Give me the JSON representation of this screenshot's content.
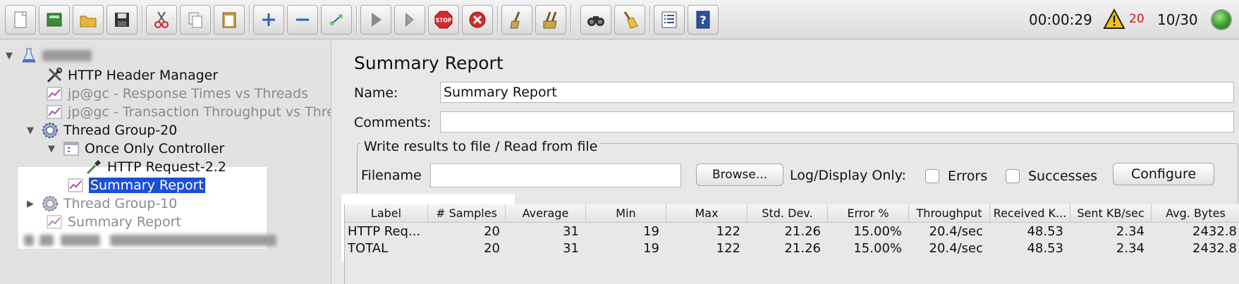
{
  "toolbar": {
    "buttons": [
      {
        "name": "new-icon"
      },
      {
        "name": "templates-icon"
      },
      {
        "name": "open-icon"
      },
      {
        "name": "save-icon"
      },
      {
        "name": "cut-icon"
      },
      {
        "name": "copy-icon"
      },
      {
        "name": "paste-icon"
      },
      {
        "name": "expand-icon"
      },
      {
        "name": "collapse-icon"
      },
      {
        "name": "toggle-icon"
      },
      {
        "name": "start-icon"
      },
      {
        "name": "start-no-pauses-icon"
      },
      {
        "name": "stop-icon"
      },
      {
        "name": "shutdown-icon"
      },
      {
        "name": "clear-icon"
      },
      {
        "name": "clear-all-icon"
      },
      {
        "name": "search-icon"
      },
      {
        "name": "reset-search-icon"
      },
      {
        "name": "function-helper-icon"
      },
      {
        "name": "help-icon"
      }
    ],
    "stop_text": "STOP",
    "timer": "00:00:29",
    "warning_count": "20",
    "threads": "10/30"
  },
  "tree": {
    "root_label": "",
    "items": [
      {
        "label": "HTTP Header Manager"
      },
      {
        "label": "jp@gc - Response Times vs Threads"
      },
      {
        "label": "jp@gc - Transaction Throughput vs Threa"
      },
      {
        "label": "Thread Group-20"
      },
      {
        "label": "Once Only Controller"
      },
      {
        "label": "HTTP Request-2.2"
      },
      {
        "label": "Summary Report"
      },
      {
        "label": "Thread Group-10"
      },
      {
        "label": "Summary Report"
      }
    ]
  },
  "panel": {
    "title": "Summary Report",
    "name_label": "Name:",
    "name_value": "Summary Report",
    "comments_label": "Comments:",
    "comments_value": "",
    "file_group_title": "Write results to file / Read from file",
    "filename_label": "Filename",
    "filename_value": "",
    "browse_label": "Browse...",
    "log_display_label": "Log/Display Only:",
    "errors_label": "Errors",
    "successes_label": "Successes",
    "configure_label": "Configure"
  },
  "table": {
    "headers": [
      "Label",
      "# Samples",
      "Average",
      "Min",
      "Max",
      "Std. Dev.",
      "Error %",
      "Throughput",
      "Received K...",
      "Sent KB/sec",
      "Avg. Bytes"
    ],
    "rows": [
      [
        "HTTP Req...",
        "20",
        "31",
        "19",
        "122",
        "21.26",
        "15.00%",
        "20.4/sec",
        "48.53",
        "2.34",
        "2432.8"
      ],
      [
        "TOTAL",
        "20",
        "31",
        "19",
        "122",
        "21.26",
        "15.00%",
        "20.4/sec",
        "48.53",
        "2.34",
        "2432.8"
      ]
    ]
  },
  "colors": {
    "selection": "#1a4fd6",
    "warning": "#d0161b",
    "status": "#2d9a20",
    "stop": "#d62b2b"
  }
}
